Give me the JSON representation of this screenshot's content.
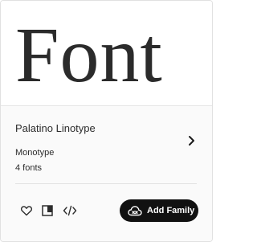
{
  "card": {
    "preview_text": "Font",
    "family_name": "Palatino Linotype",
    "foundry": "Monotype",
    "font_count": "4 fonts",
    "add_family_label": "Add Family"
  },
  "icons": {
    "favorite": "heart-icon",
    "sample": "copy-sample-icon",
    "embed": "code-icon",
    "chevron": "chevron-right-icon",
    "creative_cloud": "creative-cloud-icon"
  },
  "colors": {
    "button_bg": "#111111",
    "button_text": "#ffffff",
    "text": "#2c2c2c",
    "info_bg": "#fafafa"
  }
}
